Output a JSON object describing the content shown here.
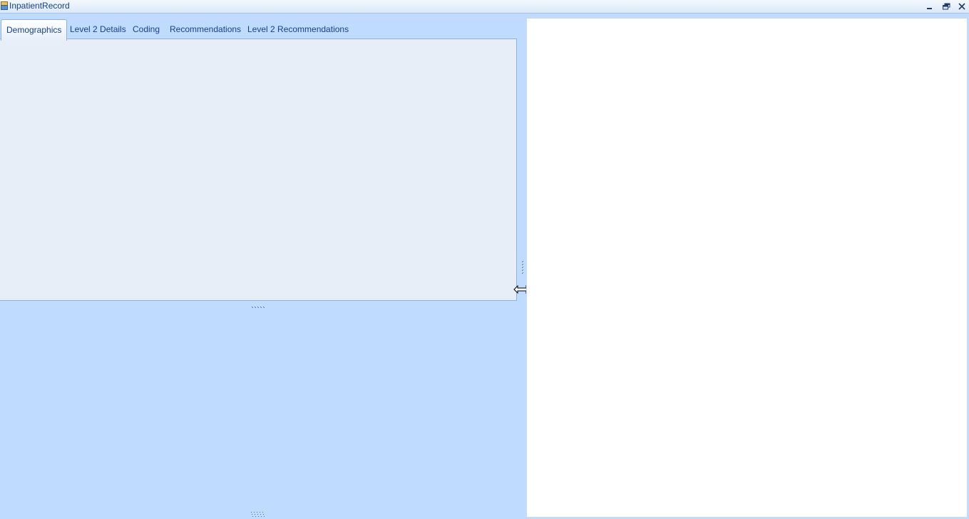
{
  "window": {
    "title": "InpatientRecord",
    "app_icon": "app-icon",
    "controls": [
      {
        "name": "minimize",
        "icon": "minimize-icon"
      },
      {
        "name": "restore",
        "icon": "restore-icon"
      },
      {
        "name": "close",
        "icon": "close-icon"
      }
    ]
  },
  "tabs": [
    {
      "label": "Demographics",
      "active": true
    },
    {
      "label": "Level 2 Details",
      "active": false
    },
    {
      "label": "Coding",
      "active": false
    },
    {
      "label": "Recommendations",
      "active": false
    },
    {
      "label": "Level 2 Recommendations",
      "active": false
    }
  ],
  "colors": {
    "background": "#bfdbff",
    "tab_panel": "#e7eef8",
    "border": "#8db2e3",
    "text": "#15428b",
    "right_pane": "#ffffff"
  },
  "cursor": "horizontal-resize-cursor"
}
